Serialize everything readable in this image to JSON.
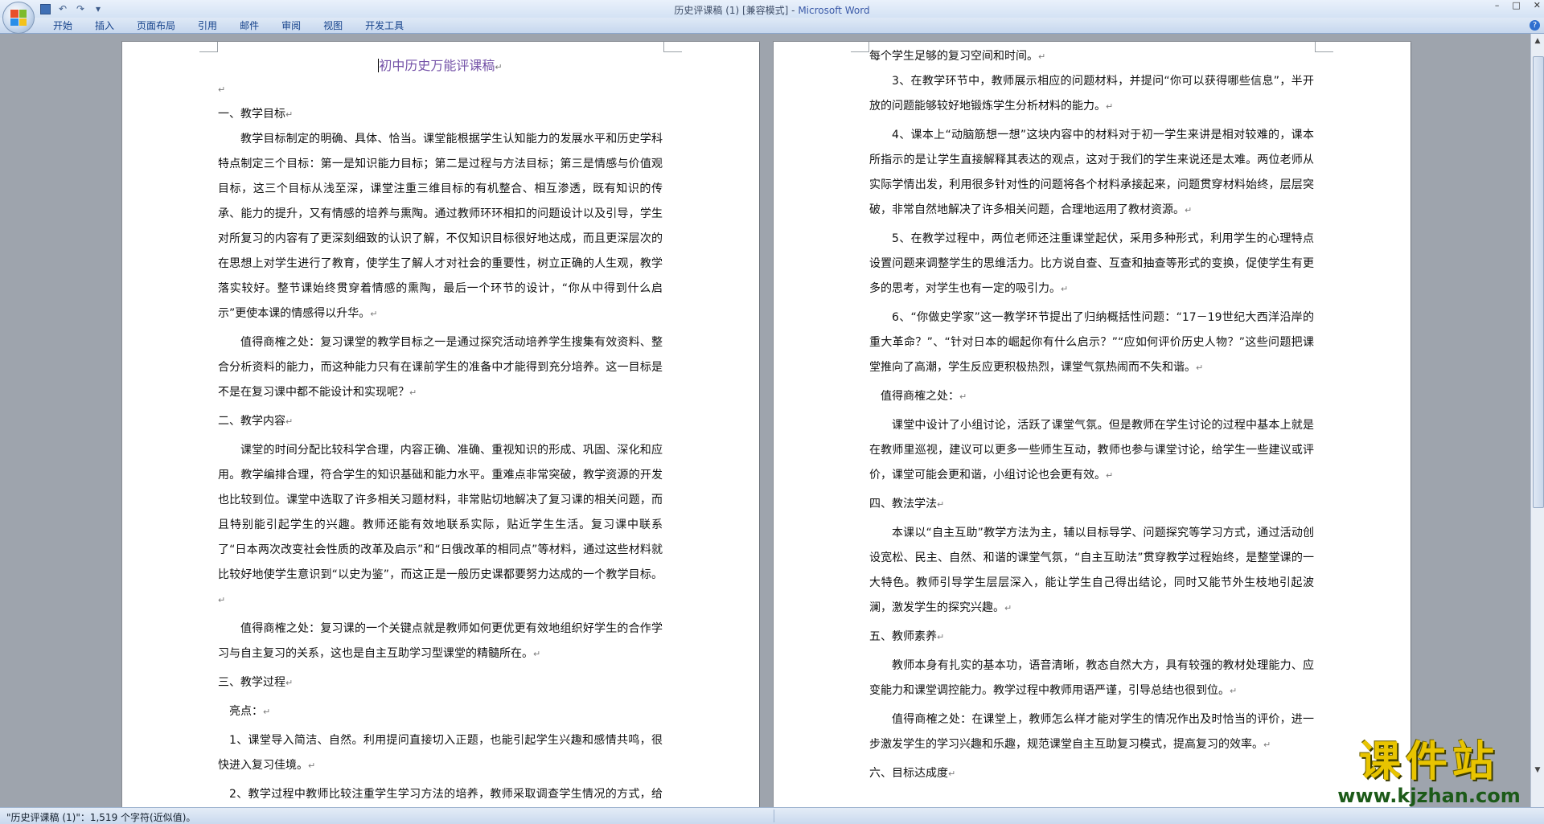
{
  "window": {
    "title_doc": "历史评课稿 (1) [兼容模式] - ",
    "title_app": "Microsoft Word",
    "controls": [
      "–",
      "□",
      "✕"
    ]
  },
  "quick_access": {
    "icons": [
      "save-icon",
      "undo-icon",
      "redo-icon",
      "customize-icon"
    ],
    "undo": "↶",
    "redo": "↷",
    "more": "▾"
  },
  "ribbon": {
    "tabs": [
      "开始",
      "插入",
      "页面布局",
      "引用",
      "邮件",
      "审阅",
      "视图",
      "开发工具"
    ],
    "help": "?"
  },
  "document": {
    "title": "初中历史万能评课稿",
    "para_mark": "↵",
    "left_paragraphs": [
      {
        "text": "",
        "style": ""
      },
      {
        "text": "一、教学目标",
        "style": ""
      },
      {
        "text": "教学目标制定的明确、具体、恰当。课堂能根据学生认知能力的发展水平和历史学科特点制定三个目标：第一是知识能力目标；第二是过程与方法目标；第三是情感与价值观目标，这三个目标从浅至深，课堂注重三维目标的有机整合、相互渗透，既有知识的传承、能力的提升，又有情感的培养与熏陶。通过教师环环相扣的问题设计以及引导，学生对所复习的内容有了更深刻细致的认识了解，不仅知识目标很好地达成，而且更深层次的在思想上对学生进行了教育，使学生了解人才对社会的重要性，树立正确的人生观，教学落实较好。整节课始终贯穿着情感的熏陶，最后一个环节的设计，“你从中得到什么启示”更使本课的情感得以升华。",
        "style": "indent"
      },
      {
        "text": "值得商榷之处：复习课堂的教学目标之一是通过探究活动培养学生搜集有效资料、整合分析资料的能力，而这种能力只有在课前学生的准备中才能得到充分培养。这一目标是不是在复习课中都不能设计和实现呢？",
        "style": "indent gap"
      },
      {
        "text": "二、教学内容",
        "style": "gap"
      },
      {
        "text": "课堂的时间分配比较科学合理，内容正确、准确、重视知识的形成、巩固、深化和应用。教学编排合理，符合学生的知识基础和能力水平。重难点非常突破，教学资源的开发也比较到位。课堂中选取了许多相关习题材料，非常贴切地解决了复习课的相关问题，而且特别能引起学生的兴趣。教师还能有效地联系实际，贴近学生生活。复习课中联系了“日本两次改变社会性质的改革及启示”和“日俄改革的相同点”等材料，通过这些材料就比较好地使学生意识到“以史为鉴”，而这正是一般历史课都要努力达成的一个教学目标。",
        "style": "indent gap"
      },
      {
        "text": "值得商榷之处：复习课的一个关键点就是教师如何更优更有效地组织好学生的合作学习与自主复习的关系，这也是自主互助学习型课堂的精髓所在。",
        "style": "indent gap"
      },
      {
        "text": "三、教学过程",
        "style": "gap"
      },
      {
        "text": "亮点：",
        "style": "half gap"
      },
      {
        "text": "1、课堂导入简洁、自然。利用提问直接切入正题，也能引起学生兴趣和感情共鸣，很快进入复习佳境。",
        "style": "half gap"
      },
      {
        "text": "2、教学过程中教师比较注重学生学习方法的培养，教师采取调查学生情况的方式，给了",
        "style": "half gap"
      }
    ],
    "right_paragraphs": [
      {
        "text": "每个学生足够的复习空间和时间。",
        "style": ""
      },
      {
        "text": "3、在教学环节中，教师展示相应的问题材料，并提问“你可以获得哪些信息”，半开放的问题能够较好地锻炼学生分析材料的能力。",
        "style": "indent"
      },
      {
        "text": "4、课本上“动脑筋想一想”这块内容中的材料对于初一学生来讲是相对较难的，课本所指示的是让学生直接解释其表达的观点，这对于我们的学生来说还是太难。两位老师从实际学情出发，利用很多针对性的问题将各个材料承接起来，问题贯穿材料始终，层层突破，非常自然地解决了许多相关问题，合理地运用了教材资源。",
        "style": "indent gap"
      },
      {
        "text": "5、在教学过程中，两位老师还注重课堂起伏，采用多种形式，利用学生的心理特点设置问题来调整学生的思维活力。比方说自查、互查和抽查等形式的变换，促使学生有更多的思考，对学生也有一定的吸引力。",
        "style": "indent gap"
      },
      {
        "text": "6、“你做史学家”这一教学环节提出了归纳概括性问题：“17－19世纪大西洋沿岸的重大革命？”、“针对日本的崛起你有什么启示？”“应如何评价历史人物？”这些问题把课堂推向了高潮，学生反应更积极热烈，课堂气氛热闹而不失和谐。",
        "style": "indent gap"
      },
      {
        "text": "值得商榷之处：",
        "style": "half gap"
      },
      {
        "text": "课堂中设计了小组讨论，活跃了课堂气氛。但是教师在学生讨论的过程中基本上就是在教师里巡视，建议可以更多一些师生互动，教师也参与课堂讨论，给学生一些建议或评价，课堂可能会更和谐，小组讨论也会更有效。",
        "style": "indent gap"
      },
      {
        "text": "四、教法学法",
        "style": "gap"
      },
      {
        "text": "本课以“自主互助”教学方法为主，辅以目标导学、问题探究等学习方式，通过活动创设宽松、民主、自然、和谐的课堂气氛，“自主互助法”贯穿教学过程始终，是整堂课的一大特色。教师引导学生层层深入，能让学生自己得出结论，同时又能节外生枝地引起波澜，激发学生的探究兴趣。",
        "style": "indent gap"
      },
      {
        "text": "五、教师素养",
        "style": "gap"
      },
      {
        "text": "教师本身有扎实的基本功，语音清晰，教态自然大方，具有较强的教材处理能力、应变能力和课堂调控能力。教学过程中教师用语严谨，引导总结也很到位。",
        "style": "indent gap"
      },
      {
        "text": "值得商榷之处：在课堂上，教师怎么样才能对学生的情况作出及时恰当的评价，进一步激发学生的学习兴趣和乐趣，规范课堂自主互助复习模式，提高复习的效率。",
        "style": "indent gap"
      },
      {
        "text": "六、目标达成度",
        "style": "gap"
      }
    ]
  },
  "status_bar": {
    "text": "\"历史评课稿 (1)\"：1,519 个字符(近似值)。"
  },
  "watermark": {
    "logo": "课件站",
    "url": "www.kjzhan.com"
  },
  "scrollbar": {
    "up": "▲",
    "down": "▼"
  }
}
